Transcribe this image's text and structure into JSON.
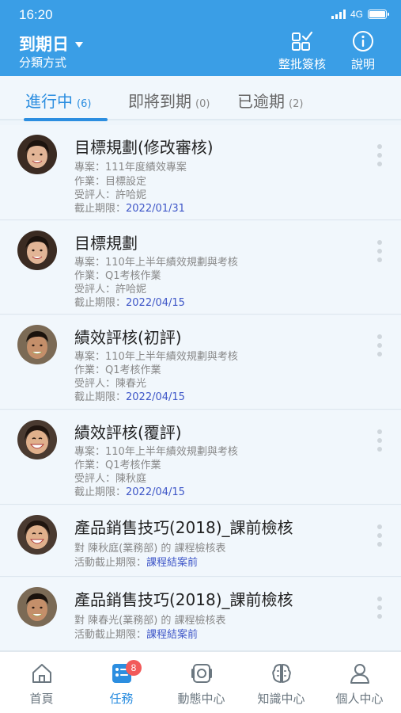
{
  "status_bar": {
    "time": "16:20",
    "network": "4G"
  },
  "header": {
    "title": "到期日",
    "subtitle": "分類方式",
    "batch_label": "整批簽核",
    "help_label": "說明"
  },
  "tabs": [
    {
      "label": "進行中",
      "count": "(6)"
    },
    {
      "label": "即將到期",
      "count": "(0)"
    },
    {
      "label": "已逾期",
      "count": "(2)"
    }
  ],
  "items": [
    {
      "title": "目標規劃(修改審核)",
      "lines": [
        {
          "label": "專案：",
          "value": "111年度績效專案"
        },
        {
          "label": "作業：",
          "value": "目標設定"
        },
        {
          "label": "受評人：",
          "value": "許哈妮"
        },
        {
          "label": "截止期限：",
          "value": "2022/01/31"
        }
      ]
    },
    {
      "title": "目標規劃",
      "lines": [
        {
          "label": "專案：",
          "value": "110年上半年績效規劃與考核"
        },
        {
          "label": "作業：",
          "value": "Q1考核作業"
        },
        {
          "label": "受評人：",
          "value": "許哈妮"
        },
        {
          "label": "截止期限：",
          "value": "2022/04/15"
        }
      ]
    },
    {
      "title": "績效評核(初評)",
      "lines": [
        {
          "label": "專案：",
          "value": "110年上半年績效規劃與考核"
        },
        {
          "label": "作業：",
          "value": "Q1考核作業"
        },
        {
          "label": "受評人：",
          "value": "陳春光"
        },
        {
          "label": "截止期限：",
          "value": "2022/04/15"
        }
      ]
    },
    {
      "title": "績效評核(覆評)",
      "lines": [
        {
          "label": "專案：",
          "value": "110年上半年績效規劃與考核"
        },
        {
          "label": "作業：",
          "value": "Q1考核作業"
        },
        {
          "label": "受評人：",
          "value": "陳秋庭"
        },
        {
          "label": "截止期限：",
          "value": "2022/04/15"
        }
      ]
    },
    {
      "title": "產品銷售技巧(2018)_課前檢核",
      "lines": [
        {
          "label": "對 陳秋庭(業務部) 的 課程檢核表",
          "value": ""
        },
        {
          "label": "活動截止期限：",
          "value": "課程結案前"
        }
      ]
    },
    {
      "title": "產品銷售技巧(2018)_課前檢核",
      "lines": [
        {
          "label": "對 陳春光(業務部) 的 課程檢核表",
          "value": ""
        },
        {
          "label": "活動截止期限：",
          "value": "課程結案前"
        }
      ]
    }
  ],
  "tabbar": [
    {
      "label": "首頁",
      "icon": "home-icon"
    },
    {
      "label": "任務",
      "icon": "task-icon",
      "badge": "8"
    },
    {
      "label": "動態中心",
      "icon": "activity-icon"
    },
    {
      "label": "知識中心",
      "icon": "brain-icon"
    },
    {
      "label": "個人中心",
      "icon": "person-icon"
    }
  ],
  "colors": {
    "accent": "#3a9ee6",
    "tab_active": "#2c8ee0",
    "badge": "#f25a5a",
    "deadline": "#3f57c8"
  }
}
